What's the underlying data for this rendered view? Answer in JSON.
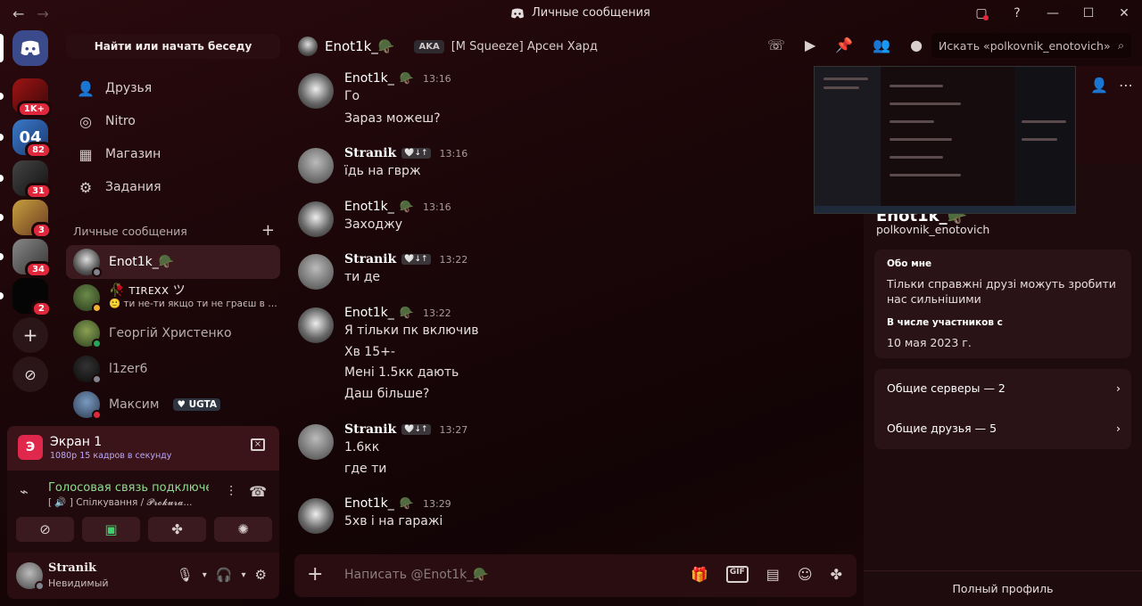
{
  "window": {
    "title": "Личные сообщения"
  },
  "colors": {
    "accent_red": "#e0283c",
    "online": "#23a55a",
    "voice_green": "#8fdc8f"
  },
  "rail": {
    "badges": [
      "1K+",
      "82",
      "31",
      "3",
      "34",
      "2"
    ]
  },
  "sidebar": {
    "search_label": "Найти или начать беседу",
    "nav": [
      {
        "label": "Друзья",
        "icon": "friends-icon"
      },
      {
        "label": "Nitro",
        "icon": "nitro-icon"
      },
      {
        "label": "Магазин",
        "icon": "shop-icon"
      },
      {
        "label": "Задания",
        "icon": "quests-icon"
      }
    ],
    "dm_header": "Личные сообщения",
    "dms": [
      {
        "name": "Enot1k_🪖",
        "sub": ""
      },
      {
        "name": "🥀 ᴛɪʀᴇxx ツ",
        "sub": "🙂 ти не-ти якщо ти не граєш в укр ..."
      },
      {
        "name": "Георгій Христенко",
        "sub": ""
      },
      {
        "name": "l1zer6",
        "sub": ""
      },
      {
        "name": "Максим",
        "sub": "",
        "tag": "UGTA"
      }
    ]
  },
  "stream": {
    "title": "Экран 1",
    "sub": "1080p 15 кадров в секунду",
    "icon_letter": "Э"
  },
  "voice": {
    "status": "Голосовая связь подключе",
    "channel": "[ 🔊 ] Спілкування / 𝓟𝓻𝓸𝓴𝓾𝓻𝓪..."
  },
  "user": {
    "name": "Stranik",
    "status": "Невидимый"
  },
  "chat": {
    "recipient": "Enot1k_🪖",
    "aka_label": "AKA",
    "alias": "[M Squeeze] Арсен Хард",
    "search_placeholder": "Искать «polkovnik_enotovich»",
    "composer_placeholder": "Написать @Enot1k_🪖",
    "messages": [
      {
        "author": "Enot1k_",
        "emoji": "🪖",
        "time": "13:16",
        "lines": [
          "Го",
          "Зараз можеш?"
        ]
      },
      {
        "author": "Stranik",
        "emoji": "🤍↓↑",
        "time": "13:16",
        "lines": [
          "їдь на гврж"
        ]
      },
      {
        "author": "Enot1k_",
        "emoji": "🪖",
        "time": "13:16",
        "lines": [
          "Заходжу"
        ]
      },
      {
        "author": "Stranik",
        "emoji": "🤍↓↑",
        "time": "13:22",
        "lines": [
          "ти де"
        ]
      },
      {
        "author": "Enot1k_",
        "emoji": "🪖",
        "time": "13:22",
        "lines": [
          "Я тільки пк включив",
          "Хв 15+-",
          "Мені 1.5кк дають",
          "Даш більше?"
        ]
      },
      {
        "author": "Stranik",
        "emoji": "🤍↓↑",
        "time": "13:27",
        "lines": [
          "1.6кк",
          "где ти"
        ]
      },
      {
        "author": "Enot1k_",
        "emoji": "🪖",
        "time": "13:29",
        "lines": [
          "5хв і на гаражі"
        ]
      }
    ]
  },
  "profile": {
    "name": "Enot1k_🪖",
    "handle": "polkovnik_enotovich",
    "about_label": "Обо мне",
    "about_text": "Тільки справжні друзі можуть зробити нас сильнішими",
    "member_since_label": "В числе участников с",
    "member_since": "10 мая 2023 г.",
    "mutual_servers": "Общие серверы — 2",
    "mutual_friends": "Общие друзья — 5",
    "full_profile": "Полный профиль"
  }
}
